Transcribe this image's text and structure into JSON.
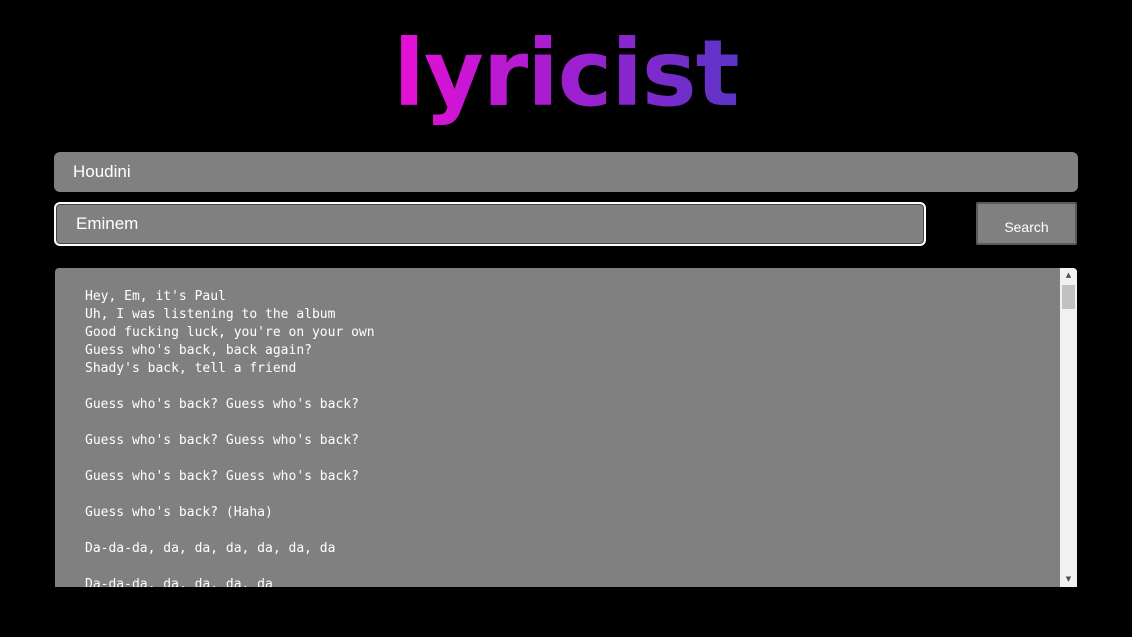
{
  "app": {
    "logo": "lyricist"
  },
  "search": {
    "song_value": "Houdini",
    "artist_value": "Eminem",
    "button_label": "Search"
  },
  "lyrics": {
    "text": "Hey, Em, it's Paul\nUh, I was listening to the album\nGood fucking luck, you're on your own\nGuess who's back, back again?\nShady's back, tell a friend\n\nGuess who's back? Guess who's back?\n\nGuess who's back? Guess who's back?\n\nGuess who's back? Guess who's back?\n\nGuess who's back? (Haha)\n\nDa-da-da, da, da, da, da, da, da\n\nDa-da-da, da, da, da, da"
  },
  "icons": {
    "scroll_up": "scroll-up-arrow-icon",
    "scroll_down": "scroll-down-arrow-icon"
  },
  "colors": {
    "background": "#000000",
    "field": "#808080",
    "logo_gradient_start": "#e80fd6",
    "logo_gradient_end": "#5a35c8"
  }
}
